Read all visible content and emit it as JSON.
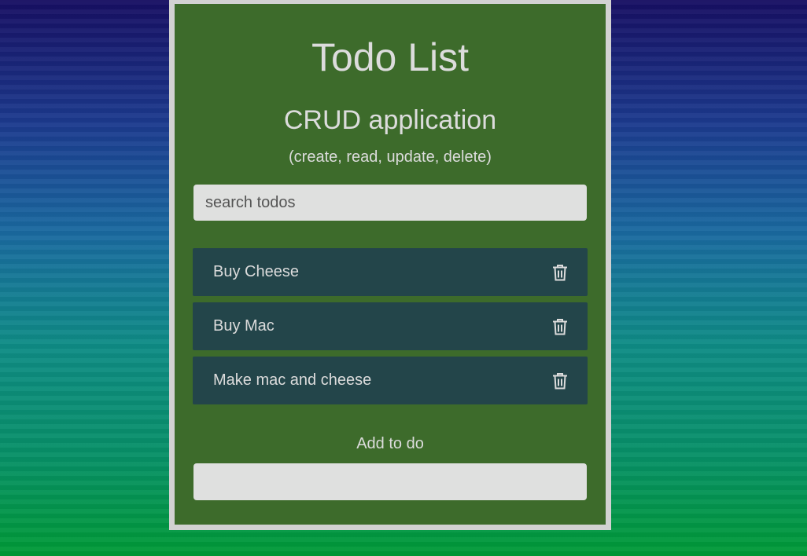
{
  "app": {
    "title": "Todo List",
    "subtitle": "CRUD application",
    "description": "(create, read, update, delete)"
  },
  "search": {
    "placeholder": "search todos",
    "value": ""
  },
  "todos": [
    {
      "text": "Buy Cheese",
      "icon": "trash-icon"
    },
    {
      "text": "Buy Mac",
      "icon": "trash-icon"
    },
    {
      "text": "Make mac and cheese",
      "icon": "trash-icon"
    }
  ],
  "add": {
    "label": "Add to do",
    "value": ""
  },
  "colors": {
    "panel": "#3d6b2b",
    "panel_border": "#d2d2d2",
    "todo_bg": "#23454a",
    "text": "#dcdcdc",
    "input_bg": "#dfe0df"
  }
}
